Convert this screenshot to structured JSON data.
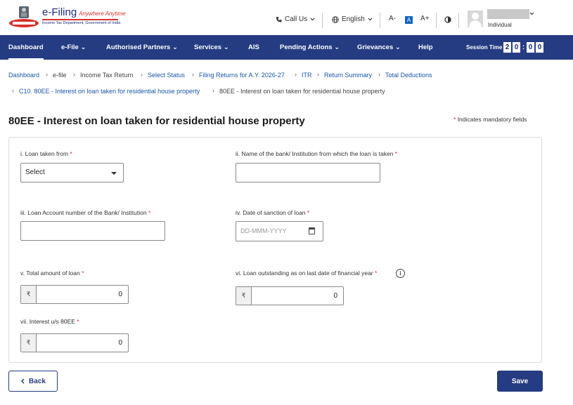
{
  "header": {
    "logo_main": "e-Filing",
    "logo_tagline": "Anywhere Anytime",
    "logo_sub": "Income Tax Department, Government of India",
    "call_us": "Call Us",
    "language": "English",
    "font_decrease": "A-",
    "font_normal": "A",
    "font_increase": "A+",
    "user_role": "Individual"
  },
  "nav": {
    "items": [
      "Dashboard",
      "e-File",
      "Authorised Partners",
      "Services",
      "AIS",
      "Pending Actions",
      "Grievances",
      "Help"
    ],
    "session_label": "Session Time",
    "timer": [
      "2",
      "0",
      "0",
      "0"
    ]
  },
  "breadcrumb": {
    "row1": [
      "Dashboard",
      "e-file",
      "Income Tax Return",
      "Select Status",
      "Filing Returns for A.Y. 2026-27",
      "ITR",
      "Return Summary",
      "Total Deductions"
    ],
    "row2": [
      "C10. 80EE - Interest on loan taken for residential house property",
      "80EE - Interest on loan taken for residential house property"
    ]
  },
  "page": {
    "title": "80EE - Interest on loan taken for residential house property",
    "mandatory_note": "Indicates mandatory fields"
  },
  "form": {
    "loan_from_label": "i. Loan taken from",
    "loan_from_value": "Select",
    "bank_name_label": "ii. Name of the bank/ Institution from which the loan is taken",
    "bank_name_value": "",
    "account_label": "iii. Loan Account number of the Bank/ Institution",
    "account_value": "",
    "sanction_label": "iv. Date of sanction of loan",
    "sanction_placeholder": "DD-MMM-YYYY",
    "total_label": "v. Total amount of loan",
    "total_value": "0",
    "outstanding_label": "vi. Loan outstanding as on last date of financial year",
    "outstanding_value": "0",
    "interest_label": "vii. Interest u/s 80EE",
    "interest_value": "0",
    "currency": "₹",
    "required_mark": "*"
  },
  "actions": {
    "back": "Back",
    "save": "Save"
  },
  "colors": {
    "nav_bg": "#253c82",
    "link": "#1a56a8",
    "required": "#d9312b"
  }
}
